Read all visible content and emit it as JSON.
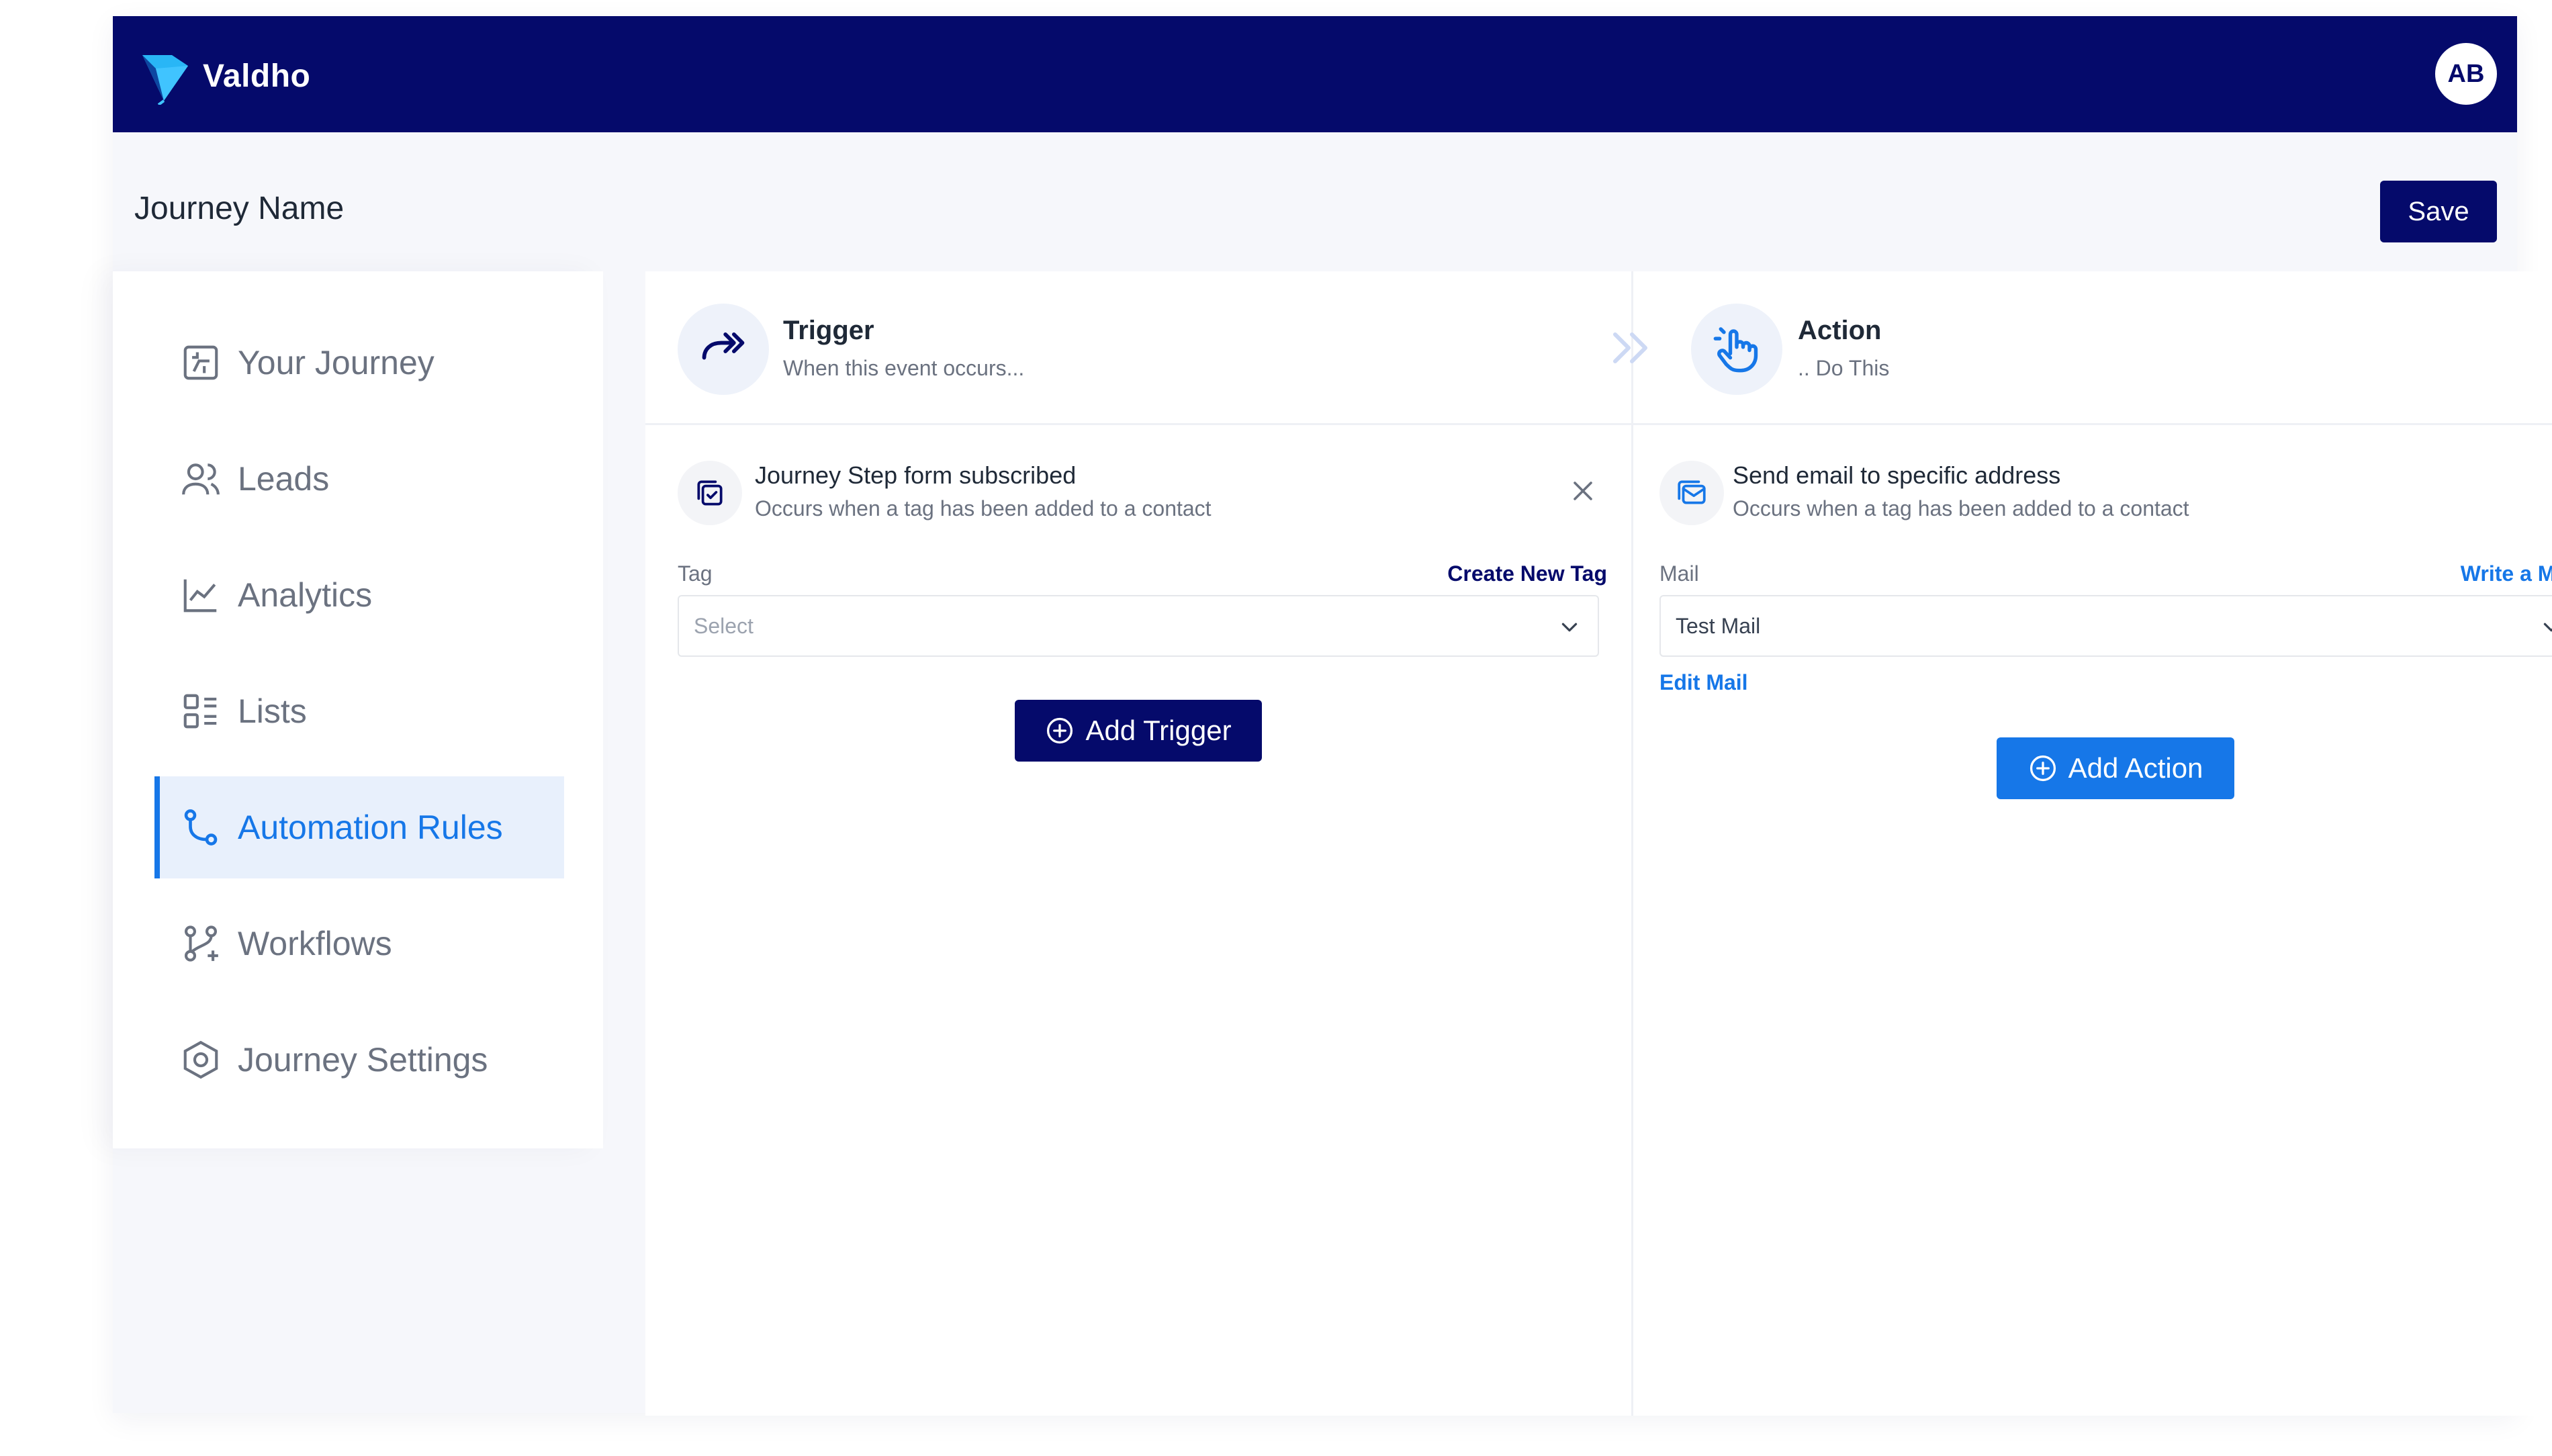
{
  "app": {
    "name": "Valdho",
    "user_initials": "AB"
  },
  "header": {
    "journey_name": "Journey Name",
    "save_label": "Save"
  },
  "sidebar": {
    "items": [
      {
        "label": "Your Journey",
        "icon": "journey-icon"
      },
      {
        "label": "Leads",
        "icon": "users-icon"
      },
      {
        "label": "Analytics",
        "icon": "chart-icon"
      },
      {
        "label": "Lists",
        "icon": "list-icon"
      },
      {
        "label": "Automation Rules",
        "icon": "automation-icon",
        "active": true
      },
      {
        "label": "Workflows",
        "icon": "workflow-icon"
      },
      {
        "label": "Journey Settings",
        "icon": "settings-icon"
      }
    ]
  },
  "trigger": {
    "title": "Trigger",
    "subtitle": "When this event occurs...",
    "item_title": "Journey Step form subscribed",
    "item_subtitle": "Occurs when a tag has been added to a contact",
    "field_label": "Tag",
    "field_link": "Create New Tag",
    "select_placeholder": "Select",
    "button_label": "Add Trigger"
  },
  "action": {
    "title": "Action",
    "subtitle": ".. Do This",
    "item_title": "Send email to specific address",
    "item_subtitle": "Occurs when a tag has been added to a contact",
    "field_label": "Mail",
    "field_link": "Write a Mail",
    "select_value": "Test Mail",
    "edit_link": "Edit Mail",
    "button_label": "Add Action"
  },
  "colors": {
    "brand_navy": "#050a6b",
    "accent_blue": "#1677e8",
    "active_bg": "#e8f0fc"
  }
}
